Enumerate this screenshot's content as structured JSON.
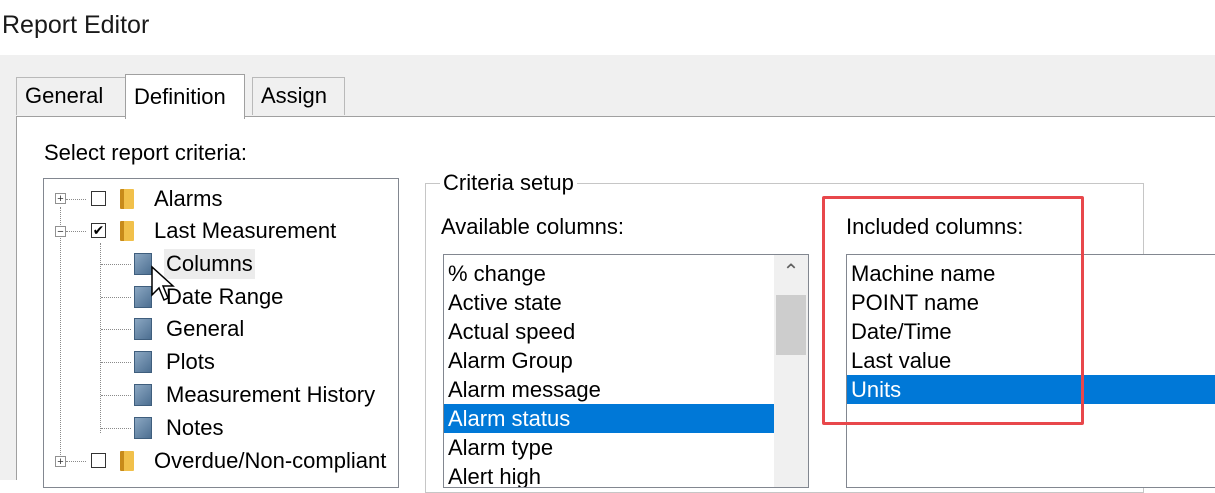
{
  "window": {
    "title": "Report Editor"
  },
  "tabs": [
    {
      "label": "General"
    },
    {
      "label": "Definition"
    },
    {
      "label": "Assign"
    }
  ],
  "tree": {
    "label": "Select report criteria:",
    "items": [
      {
        "label": "Alarms",
        "expander": "+",
        "checked": false
      },
      {
        "label": "Last Measurement",
        "expander": "−",
        "checked": true
      },
      {
        "label": "Columns"
      },
      {
        "label": "Date Range"
      },
      {
        "label": "General"
      },
      {
        "label": "Plots"
      },
      {
        "label": "Measurement History"
      },
      {
        "label": "Notes"
      },
      {
        "label": "Overdue/Non-compliant",
        "expander": "+",
        "checked": false
      }
    ]
  },
  "criteria": {
    "legend": "Criteria setup",
    "available_label": "Available columns:",
    "available_items": [
      "% change",
      "Active state",
      "Actual speed",
      "Alarm Group",
      "Alarm message",
      "Alarm status",
      "Alarm type",
      "Alert high"
    ],
    "available_selected": "Alarm status",
    "included_label": "Included columns:",
    "included_items": [
      "Machine name",
      "POINT name",
      "Date/Time",
      "Last value",
      "Units"
    ],
    "included_selected": "Units"
  },
  "icons": {
    "checkmark": "✔",
    "scroll_up": "⌃"
  },
  "colors": {
    "selection": "#0078d7",
    "highlight_box": "#e8474b"
  }
}
